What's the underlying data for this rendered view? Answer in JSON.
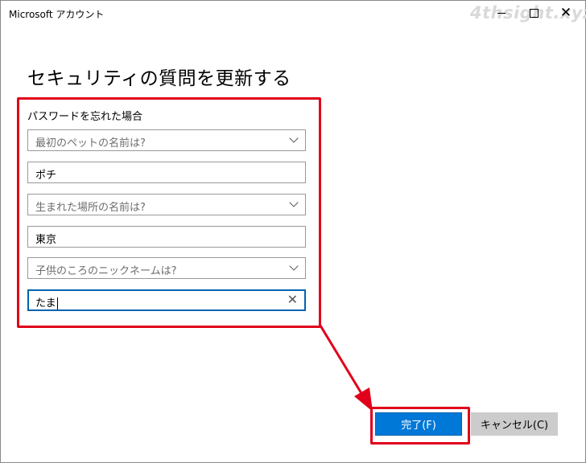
{
  "window": {
    "title": "Microsoft アカウント",
    "watermark": "4thsight.xyz"
  },
  "page": {
    "heading": "セキュリティの質問を更新する",
    "section_label": "パスワードを忘れた場合"
  },
  "questions": [
    {
      "question": "最初のペットの名前は?",
      "answer": "ポチ"
    },
    {
      "question": "生まれた場所の名前は?",
      "answer": "東京"
    },
    {
      "question": "子供のころのニックネームは?",
      "answer": "たま"
    }
  ],
  "buttons": {
    "done": "完了(F)",
    "cancel": "キャンセル(C)"
  },
  "colors": {
    "accent": "#0078d7",
    "highlight": "#e0001b",
    "secondary_button": "#cccccc"
  }
}
